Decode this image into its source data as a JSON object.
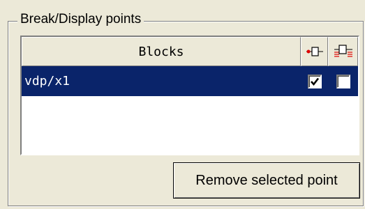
{
  "group": {
    "title": "Break/Display points"
  },
  "table": {
    "columns": [
      {
        "label": "Blocks"
      },
      {
        "icon": "breakpoint-icon"
      },
      {
        "icon": "display-point-icon"
      }
    ],
    "rows": [
      {
        "block": "vdp/x1",
        "breakpoint_checked": true,
        "display_checked": false,
        "selected": true
      }
    ]
  },
  "buttons": {
    "remove_label": "Remove selected point"
  },
  "colors": {
    "selection": "#0a246a",
    "background": "#ece9d8",
    "icon_red": "#e00000"
  }
}
